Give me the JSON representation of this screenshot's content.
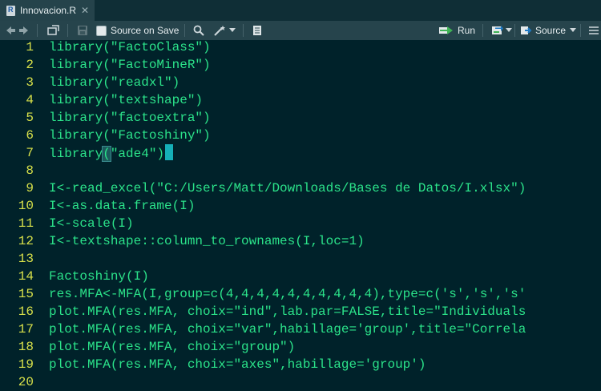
{
  "tab": {
    "filename": "Innovacion.R",
    "close_glyph": "✕"
  },
  "toolbar": {
    "source_on_save": "Source on Save",
    "run": "Run",
    "source": "Source"
  },
  "editor": {
    "lines": [
      {
        "num": "1",
        "text": "library(\"FactoClass\")"
      },
      {
        "num": "2",
        "text": "library(\"FactoMineR\")"
      },
      {
        "num": "3",
        "text": "library(\"readxl\")"
      },
      {
        "num": "4",
        "text": "library(\"textshape\")"
      },
      {
        "num": "5",
        "text": "library(\"factoextra\")"
      },
      {
        "num": "6",
        "text": "library(\"Factoshiny\")"
      },
      {
        "num": "7",
        "pre": "library",
        "paren": "(",
        "post": "\"ade4\")"
      },
      {
        "num": "8",
        "text": ""
      },
      {
        "num": "9",
        "text": "I<-read_excel(\"C:/Users/Matt/Downloads/Bases de Datos/I.xlsx\")"
      },
      {
        "num": "10",
        "text": "I<-as.data.frame(I)"
      },
      {
        "num": "11",
        "text": "I<-scale(I)"
      },
      {
        "num": "12",
        "text": "I<-textshape::column_to_rownames(I,loc=1)"
      },
      {
        "num": "13",
        "text": ""
      },
      {
        "num": "14",
        "text": "Factoshiny(I)"
      },
      {
        "num": "15",
        "text": "res.MFA<-MFA(I,group=c(4,4,4,4,4,4,4,4,4,4),type=c('s','s','s'"
      },
      {
        "num": "16",
        "text": "plot.MFA(res.MFA, choix=\"ind\",lab.par=FALSE,title=\"Individuals"
      },
      {
        "num": "17",
        "text": "plot.MFA(res.MFA, choix=\"var\",habillage='group',title=\"Correla"
      },
      {
        "num": "18",
        "text": "plot.MFA(res.MFA, choix=\"group\")"
      },
      {
        "num": "19",
        "text": "plot.MFA(res.MFA, choix=\"axes\",habillage='group')"
      },
      {
        "num": "20",
        "text": ""
      }
    ]
  },
  "colors": {
    "background": "#00222a",
    "line_numbers": "#d7e04a",
    "code": "#2be38a",
    "cursor": "#15b0b8"
  }
}
